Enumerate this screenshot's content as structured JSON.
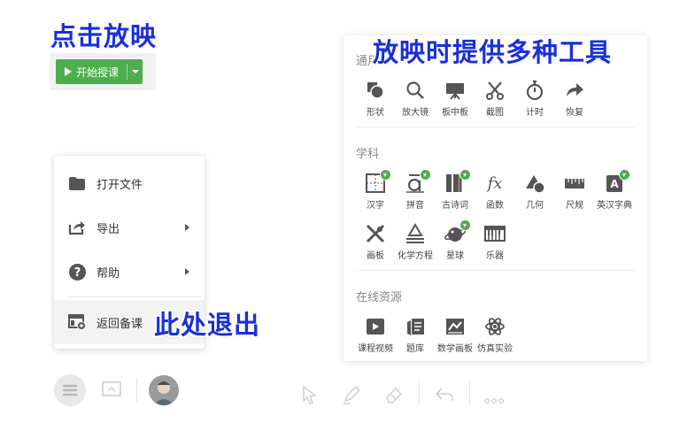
{
  "annotations": {
    "click_to_play": "点击放映",
    "tools_hint": "放映时提供多种工具",
    "exit_hint": "此处退出"
  },
  "start_button": {
    "label": "开始授课"
  },
  "menu": {
    "items": [
      {
        "label": "打开文件",
        "icon": "folder-icon"
      },
      {
        "label": "导出",
        "icon": "export-icon"
      },
      {
        "label": "帮助",
        "icon": "help-icon"
      },
      {
        "label": "返回备课",
        "icon": "return-icon"
      }
    ]
  },
  "tools_panel": {
    "general": {
      "title": "通用",
      "items": [
        {
          "label": "形状",
          "icon": "shape-icon"
        },
        {
          "label": "放大镜",
          "icon": "magnifier-icon"
        },
        {
          "label": "板中板",
          "icon": "board-icon"
        },
        {
          "label": "截图",
          "icon": "scissors-icon"
        },
        {
          "label": "计时",
          "icon": "stopwatch-icon"
        },
        {
          "label": "恢复",
          "icon": "restore-icon"
        }
      ]
    },
    "subject": {
      "title": "学科",
      "items": [
        {
          "label": "汉字",
          "icon": "hanzi-icon"
        },
        {
          "label": "拼音",
          "icon": "pinyin-icon"
        },
        {
          "label": "古诗词",
          "icon": "poem-icon"
        },
        {
          "label": "函数",
          "icon": "function-icon"
        },
        {
          "label": "几何",
          "icon": "geometry-icon"
        },
        {
          "label": "尺规",
          "icon": "ruler-icon"
        },
        {
          "label": "英汉字典",
          "icon": "dictionary-icon"
        },
        {
          "label": "画板",
          "icon": "drawing-board-icon"
        },
        {
          "label": "化学方程",
          "icon": "chemistry-icon"
        },
        {
          "label": "星球",
          "icon": "planet-icon"
        },
        {
          "label": "乐器",
          "icon": "piano-icon"
        }
      ]
    },
    "online": {
      "title": "在线资源",
      "items": [
        {
          "label": "课程视频",
          "icon": "video-icon"
        },
        {
          "label": "题库",
          "icon": "question-bank-icon"
        },
        {
          "label": "数学画板",
          "icon": "math-board-icon"
        },
        {
          "label": "仿真实验",
          "icon": "atom-icon"
        }
      ]
    }
  },
  "colors": {
    "accent": "#4cae4c",
    "annotation": "#1a2fd8"
  }
}
